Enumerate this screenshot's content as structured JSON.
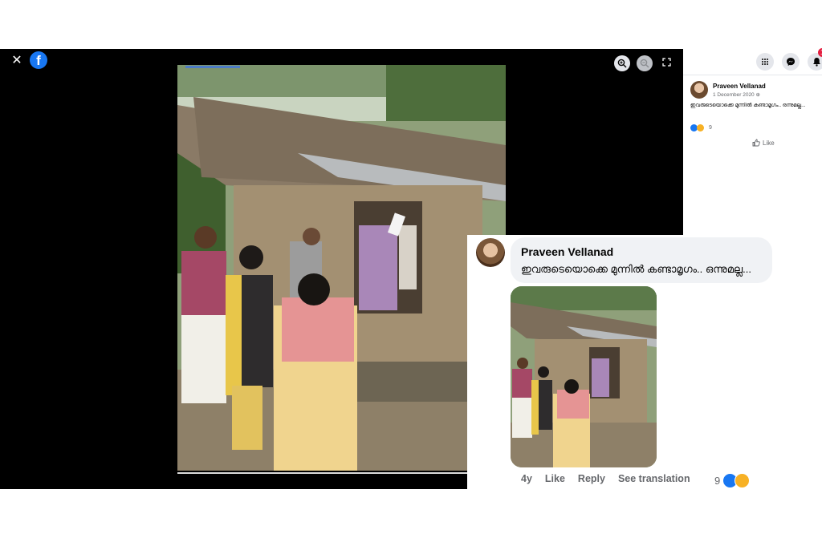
{
  "viewer": {
    "close_glyph": "✕",
    "logo_letter": "f",
    "tools": [
      "zoom-in-icon",
      "zoom-out-icon",
      "fullscreen-icon"
    ]
  },
  "topnav": {
    "notifications_count": "19",
    "icons": [
      "menu-grid-icon",
      "messenger-icon",
      "bell-icon"
    ]
  },
  "post": {
    "author": "Praveen Vellanad",
    "date": "1 December 2020",
    "text": "ഇവരുടെയൊക്കെ മുന്നിൽ കണ്ടാമൃഗം.. ഒന്നുമല്ല...",
    "reaction_count": "9",
    "like_label": "Like"
  },
  "comment": {
    "author": "Praveen Vellanad",
    "text": "ഇവരുടെയൊക്കെ മുന്നിൽ കണ്ടാമൃഗം.. ഒന്നുമല്ല...",
    "age": "4y",
    "like_label": "Like",
    "reply_label": "Reply",
    "translate_label": "See translation",
    "reaction_count": "9"
  },
  "colors": {
    "brand": "#1877f2",
    "badge": "#e41e3f",
    "bubble": "#f0f2f5",
    "muted_text": "#65676b"
  }
}
